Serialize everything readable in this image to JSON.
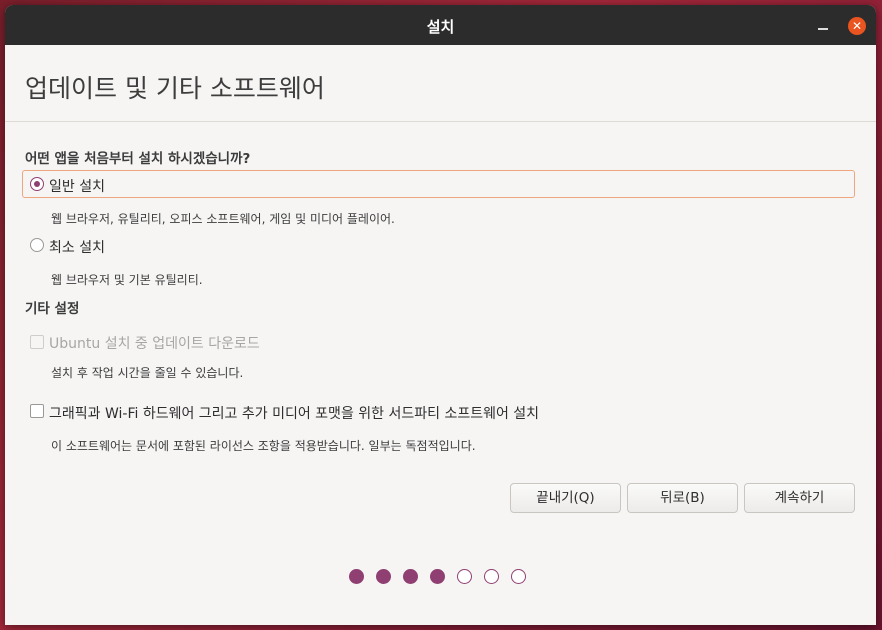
{
  "window": {
    "title": "설치",
    "controls": {
      "minimize_icon": "minimize-icon",
      "close_icon": "close-icon",
      "close_glyph": "✕"
    }
  },
  "page": {
    "heading": "업데이트 및 기타 소프트웨어",
    "question": "어떤 앱을 처음부터 설치 하시겠습니까?"
  },
  "options": {
    "normal": {
      "label": "일반 설치",
      "desc": "웹 브라우저, 유틸리티, 오피스  소프트웨어, 게임 및 미디어 플레이어.",
      "selected": true
    },
    "minimal": {
      "label": "최소 설치",
      "desc": "웹 브라우저 및 기본 유틸리티.",
      "selected": false
    }
  },
  "other": {
    "heading": "기타 설정",
    "updates": {
      "label": "Ubuntu 설치 중 업데이트 다운로드",
      "desc": "설치 후 작업 시간을 줄일 수 있습니다.",
      "checked": false,
      "disabled": true
    },
    "thirdparty": {
      "label": "그래픽과 Wi-Fi 하드웨어 그리고 추가 미디어 포맷을 위한 서드파티 소프트웨어 설치",
      "desc": "이 소프트웨어는 문서에 포함된 라이선스 조항을 적용받습니다. 일부는 독점적입니다.",
      "checked": false,
      "disabled": false
    }
  },
  "buttons": {
    "quit": "끝내기(Q)",
    "back": "뒤로(B)",
    "continue": "계속하기"
  },
  "progress": {
    "total_steps": 7,
    "completed_steps": 4
  },
  "colors": {
    "accent": "#8f3f71",
    "focus": "#eea680",
    "titlebar": "#2c2c2c",
    "close": "#e95420"
  }
}
